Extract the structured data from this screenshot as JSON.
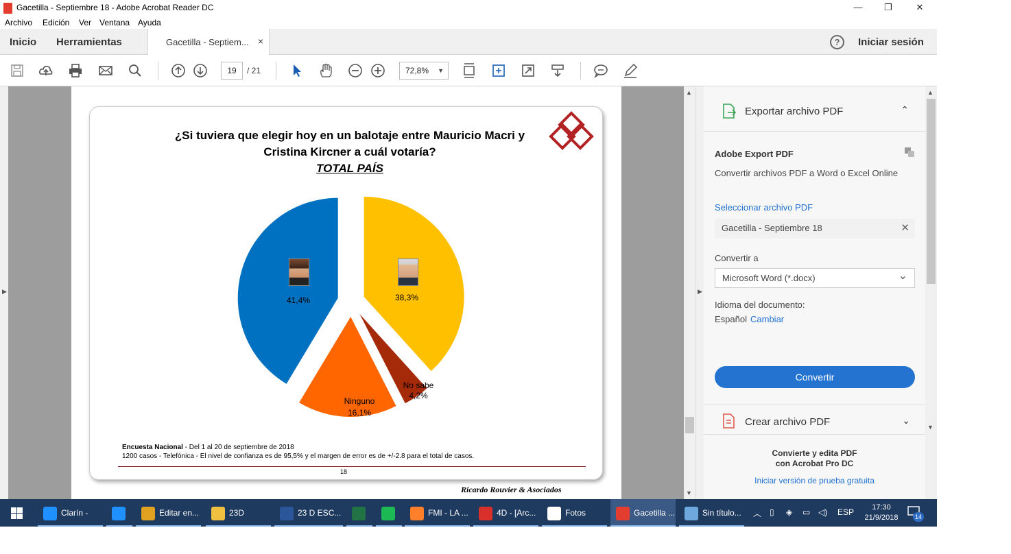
{
  "window": {
    "title": "Gacetilla  - Septiembre 18 - Adobe Acrobat Reader DC",
    "minimize": "—",
    "restore": "❐",
    "close": "✕"
  },
  "menu": [
    "Archivo",
    "Edición",
    "Ver",
    "Ventana",
    "Ayuda"
  ],
  "tabs": {
    "home": "Inicio",
    "tools": "Herramientas",
    "document": "Gacetilla  - Septiem...",
    "document_close": "×",
    "help": "?",
    "signin": "Iniciar sesión"
  },
  "toolbar": {
    "page_current": "19",
    "page_total": "/  21",
    "zoom": "72,8%",
    "zoom_caret": "▼"
  },
  "slide": {
    "title": "¿Si tuviera que elegir hoy en un balotaje entre Mauricio Macri y Cristina Kircner a cuál votaría?",
    "subtitle": "TOTAL PAÍS",
    "footer_bold": "Encuesta Nacional",
    "footer_line1_rest": "  - Del 1 al 20 de septiembre de 2018",
    "footer_line2": "1200 casos - Telefónica  - El nivel de confianza es de 95,5% y el margen de error es de +/-2.8 para el total de casos.",
    "page_number": "18",
    "brand": "Ricardo Rouvier & Asociados"
  },
  "chart_data": {
    "type": "pie",
    "title": "¿Si tuviera que elegir hoy en un balotaje entre Mauricio Macri y Cristina Kircner a cuál votaría?",
    "subtitle": "TOTAL PAÍS",
    "slices": [
      {
        "label": "",
        "value": 38.3,
        "display": "38,3%",
        "color": "#FFC000"
      },
      {
        "label": "No sabe",
        "value": 4.2,
        "display": "4,2%",
        "color": "#A52A0A"
      },
      {
        "label": "Ninguno",
        "value": 16.1,
        "display": "16,1%",
        "color": "#FF6600"
      },
      {
        "label": "",
        "value": 41.4,
        "display": "41,4%",
        "color": "#0070C0"
      }
    ]
  },
  "panel": {
    "export_title": "Exportar archivo PDF",
    "export_chevron": "⌃",
    "service_name": "Adobe Export PDF",
    "service_desc": "Convertir archivos PDF a Word o Excel Online",
    "select_link": "Seleccionar archivo PDF",
    "selected_file": "Gacetilla - Septiembre 18",
    "clear_icon": "✕",
    "convert_to_label": "Convertir a",
    "convert_to_value": "Microsoft Word (*.docx)",
    "dropdown_chevron": "⌄",
    "lang_label": "Idioma del documento:",
    "lang_value": "Español",
    "lang_change": "Cambiar",
    "convert_button": "Convertir",
    "create_title": "Crear archivo PDF",
    "create_chevron": "⌄",
    "promo_line1": "Convierte y edita PDF",
    "promo_line2": "con Acrobat Pro DC",
    "promo_link": "Iniciar versión de prueba gratuita"
  },
  "taskbar": {
    "items": [
      {
        "label": "Clarín - Ú...",
        "color": "#1e90ff"
      },
      {
        "label": "",
        "color": "#1e90ff"
      },
      {
        "label": "Editar en...",
        "color": "#e0a020"
      },
      {
        "label": "23D",
        "color": "#f0c040"
      },
      {
        "label": "23 D ESC...",
        "color": "#2b579a"
      },
      {
        "label": "",
        "color": "#217346"
      },
      {
        "label": "",
        "color": "#1db954"
      },
      {
        "label": "FMI - LA ...",
        "color": "#ff7f2a"
      },
      {
        "label": "4D - [Arc...",
        "color": "#d9302c"
      },
      {
        "label": "Fotos",
        "color": "#ffffff"
      },
      {
        "label": "Gacetilla ...",
        "color": "#e23d2f"
      },
      {
        "label": "Sin título...",
        "color": "#6fa8dc"
      }
    ],
    "lang": "ESP",
    "time": "17:30",
    "date": "21/9/2018",
    "notifications": "14"
  }
}
